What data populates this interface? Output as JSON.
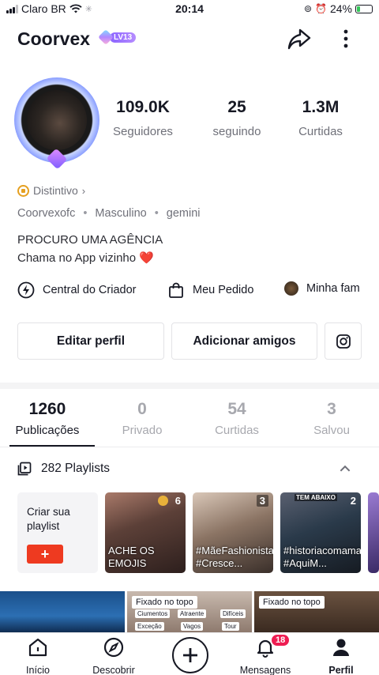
{
  "status_bar": {
    "carrier": "Claro BR",
    "time": "20:14",
    "battery": "24%",
    "battery_level": 0.24
  },
  "header": {
    "username": "Coorvex",
    "level_badge": "LV13",
    "share_icon": "share-arrow-icon",
    "more_icon": "more-vertical-icon"
  },
  "stats": [
    {
      "value": "109.0K",
      "label": "Seguidores"
    },
    {
      "value": "25",
      "label": "seguindo"
    },
    {
      "value": "1.3M",
      "label": "Curtidas"
    }
  ],
  "profile": {
    "badge_label": "Distintivo",
    "handle": "Coorvexofc",
    "gender": "Masculino",
    "sign": "gemini",
    "bio_line1": "PROCURO UMA AGÊNCIA",
    "bio_line2": "Chama no App vizinho",
    "bio_emoji": "❤️"
  },
  "links": {
    "creator_center": "Central do Criador",
    "my_order": "Meu Pedido",
    "family": "Minha fam"
  },
  "buttons": {
    "edit_profile": "Editar perfil",
    "add_friends": "Adicionar amigos"
  },
  "tabs": [
    {
      "count": "1260",
      "label": "Publicações"
    },
    {
      "count": "0",
      "label": "Privado"
    },
    {
      "count": "54",
      "label": "Curtidas"
    },
    {
      "count": "3",
      "label": "Salvou"
    }
  ],
  "playlists": {
    "header": "282 Playlists",
    "create_label": "Criar sua playlist",
    "create_button": "+",
    "items": [
      {
        "count": "6",
        "caption": "ACHE OS EMOJIS",
        "overlay": "ACHE OS EMOJIS"
      },
      {
        "count": "3",
        "caption": "#MãeFashionista #Cresce..."
      },
      {
        "count": "2",
        "caption": "#historiacomamae #AquiM...",
        "overlay": "TEM ABAIXO"
      }
    ]
  },
  "videos": [
    {
      "pinned": ""
    },
    {
      "pinned": "Fixado no topo",
      "labels": [
        "Ciumentos",
        "Atraente",
        "Difíceis",
        "Exceção",
        "Vagos",
        "Tour"
      ]
    },
    {
      "pinned": "Fixado no topo"
    }
  ],
  "bottom_nav": {
    "home": "Início",
    "discover": "Descobrir",
    "messages": "Mensagens",
    "messages_badge": "18",
    "profile": "Perfil"
  },
  "colors": {
    "accent_red": "#ee3a20",
    "badge_red": "#ee1d52",
    "level_purple": "#8a63ff"
  }
}
